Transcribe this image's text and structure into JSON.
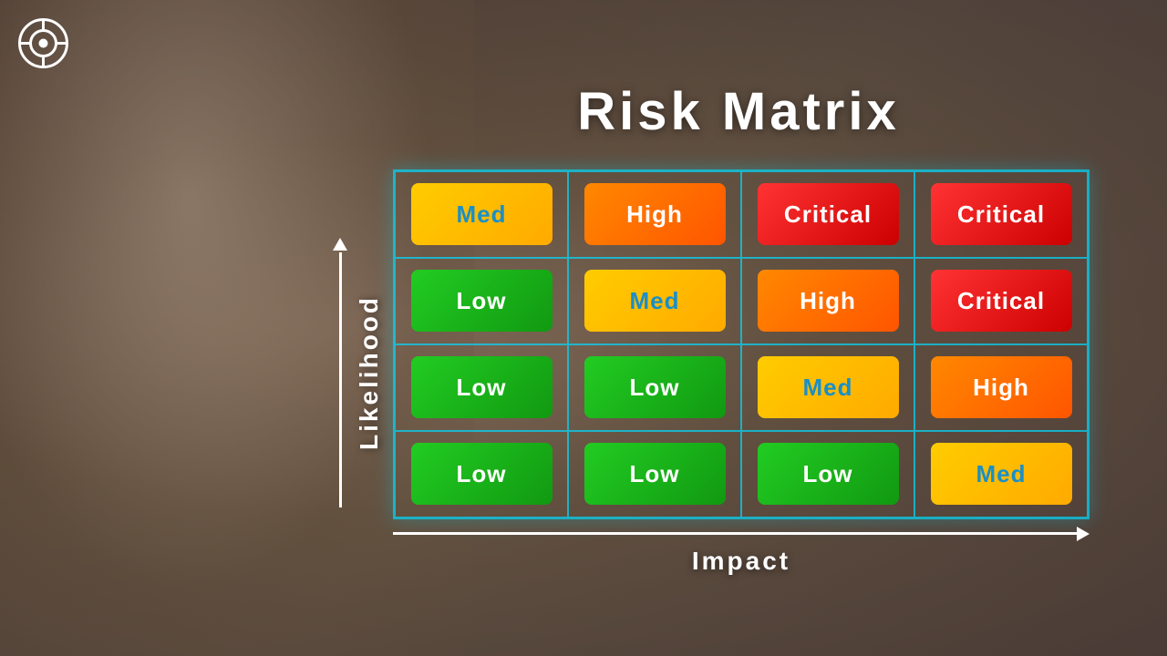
{
  "title": "Risk Matrix",
  "yAxisLabel": "Likelihood",
  "xAxisLabel": "Impact",
  "grid": [
    [
      {
        "level": "med",
        "label": "Med"
      },
      {
        "level": "high",
        "label": "High"
      },
      {
        "level": "critical",
        "label": "Critical"
      },
      {
        "level": "critical",
        "label": "Critical"
      }
    ],
    [
      {
        "level": "low",
        "label": "Low"
      },
      {
        "level": "med",
        "label": "Med"
      },
      {
        "level": "high",
        "label": "High"
      },
      {
        "level": "critical",
        "label": "Critical"
      }
    ],
    [
      {
        "level": "low",
        "label": "Low"
      },
      {
        "level": "low",
        "label": "Low"
      },
      {
        "level": "med",
        "label": "Med"
      },
      {
        "level": "high",
        "label": "High"
      }
    ],
    [
      {
        "level": "low",
        "label": "Low"
      },
      {
        "level": "low",
        "label": "Low"
      },
      {
        "level": "low",
        "label": "Low"
      },
      {
        "level": "med",
        "label": "Med"
      }
    ]
  ],
  "logo": {
    "alt": "company logo"
  }
}
